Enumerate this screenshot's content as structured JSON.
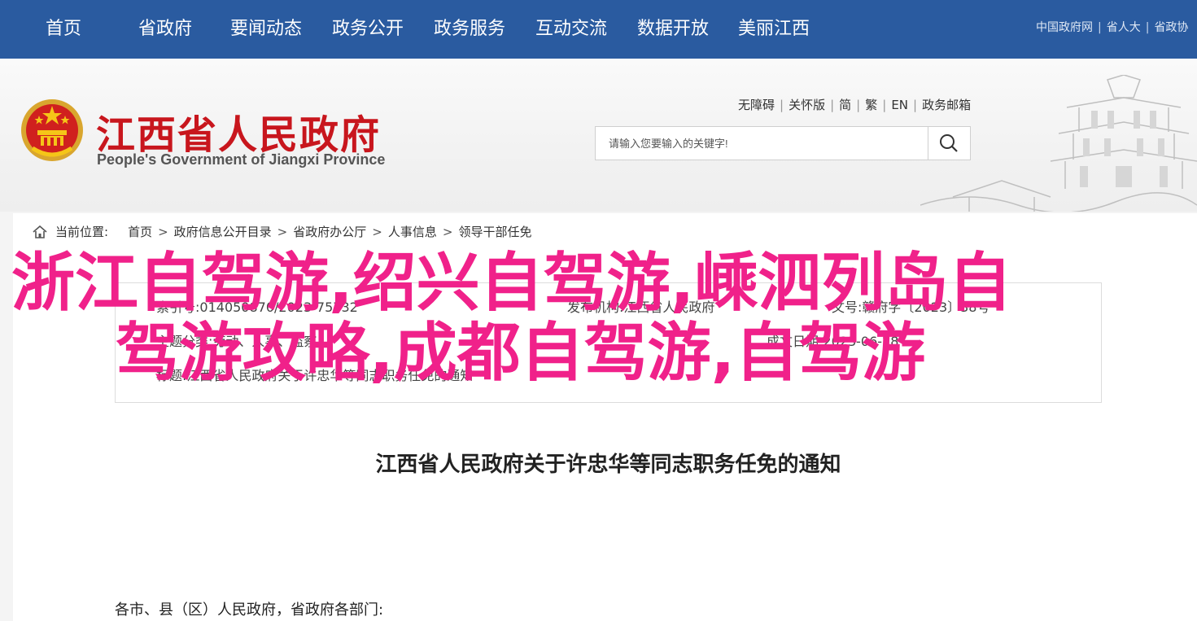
{
  "topnav": {
    "items": [
      "首页",
      "省政府",
      "要闻动态",
      "政务公开",
      "政务服务",
      "互动交流",
      "数据开放",
      "美丽江西"
    ],
    "links": [
      "中国政府网",
      "省人大",
      "省政协"
    ]
  },
  "header": {
    "title_cn": "江西省人民政府",
    "title_en": "People's Government of Jiangxi Province",
    "util_links": [
      "无障碍",
      "关怀版",
      "简",
      "繁",
      "EN",
      "政务邮箱"
    ],
    "search_placeholder": "请输入您要输入的关键字!"
  },
  "breadcrumb": {
    "label": "当前位置:",
    "items": [
      "首页",
      "政府信息公开目录",
      "省政府办公厅",
      "人事信息",
      "领导干部任免"
    ]
  },
  "info": {
    "index_label": "索引号:",
    "index_value": "014050870/2023-75732",
    "publisher_label": "发布机构:",
    "publisher_value": "江西省人民政府",
    "docno_label": "文号:",
    "docno_value": "赣府字〔2023〕38号",
    "topic_label": "主题分类:",
    "topic_value": "劳动、人事、监察",
    "date_label": "成文日期:",
    "date_value": "2023-06-28",
    "title_label": "标题:",
    "title_value": "江西省人民政府关于许忠华等同志职务任免的通知"
  },
  "document": {
    "title": "江西省人民政府关于许忠华等同志职务任免的通知",
    "salutation": "各市、县（区）人民政府，省政府各部门:"
  },
  "overlay": {
    "line1": "浙江自驾游,绍兴自驾游,嵊泗列岛自",
    "line2": "驾游攻略,成都自驾游,自驾游"
  },
  "colors": {
    "nav_bg": "#2a5ba0",
    "title_red": "#c8161d",
    "overlay_pink": "#f0218a"
  }
}
